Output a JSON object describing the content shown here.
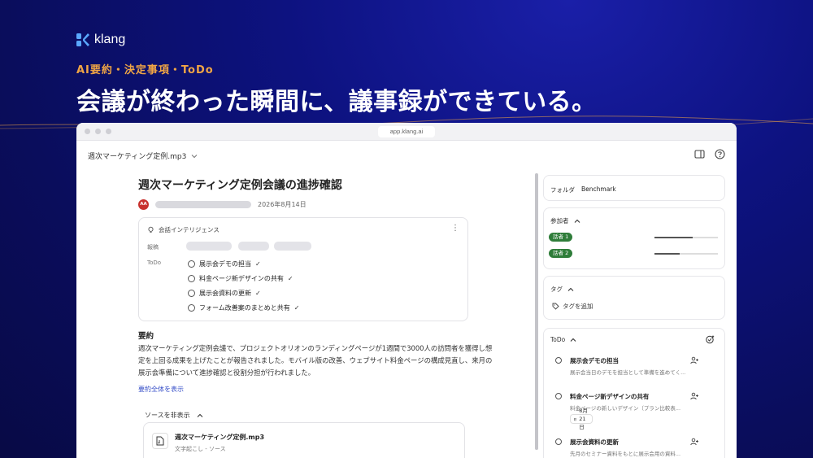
{
  "brand": {
    "name": "klang"
  },
  "hero": {
    "tagline": "AI要約・決定事項・ToDo",
    "headline": "会議が終わった瞬間に、議事録ができている。"
  },
  "window": {
    "url": "app.klang.ai"
  },
  "toolbar": {
    "file_title": "週次マーケティング定例.mp3"
  },
  "doc": {
    "title": "週次マーケティング定例会議の進捗確認",
    "avatar": "AA",
    "date": "2026年8月14日"
  },
  "intelligence": {
    "heading": "会話インテリジェンス",
    "decisions_label": "報稿",
    "todo_label": "ToDo",
    "todos": [
      "展示会デモの担当",
      "料金ページ新デザインの共有",
      "展示会資料の更新",
      "フォーム改善案のまとめと共有"
    ]
  },
  "summary": {
    "heading": "要約",
    "text": "週次マーケティング定例会議で、プロジェクトオリオンのランディングページが1週間で3000人の訪問者を獲得し想定を上回る成果を上げたことが報告されました。モバイル版の改善、ウェブサイト料金ページの構成見直し、来月の展示会準備について進捗確認と役割分担が行われました。",
    "show_all": "要約全体を表示"
  },
  "sources": {
    "toggle_label": "ソースを非表示",
    "file_name": "週次マーケティング定例.mp3",
    "file_sub": "文字起こし - ソース"
  },
  "side": {
    "folder": {
      "label": "フォルダ",
      "value": "Benchmark"
    },
    "participants": {
      "label": "参加者",
      "speakers": [
        {
          "name": "話者 1",
          "share": 0.6
        },
        {
          "name": "話者 2",
          "share": 0.4
        }
      ]
    },
    "tags": {
      "label": "タグ",
      "add_label": "タグを追加"
    },
    "todo": {
      "label": "ToDo",
      "items": [
        {
          "title": "展示会デモの担当",
          "desc": "展示会当日のデモを担当として準備を進めてく..."
        },
        {
          "title": "料金ページ新デザインの共有",
          "desc": "料金ページの新しいデザイン（プラン比較表...",
          "date": "8月21日"
        },
        {
          "title": "展示会資料の更新",
          "desc": "先月のセミナー資料をもとに展示会用の資料..."
        }
      ]
    }
  },
  "colors": {
    "accent_orange": "#f0a545",
    "speaker_green": "#2f7d3a",
    "avatar_red": "#c8312d",
    "link_blue": "#3850c8"
  }
}
